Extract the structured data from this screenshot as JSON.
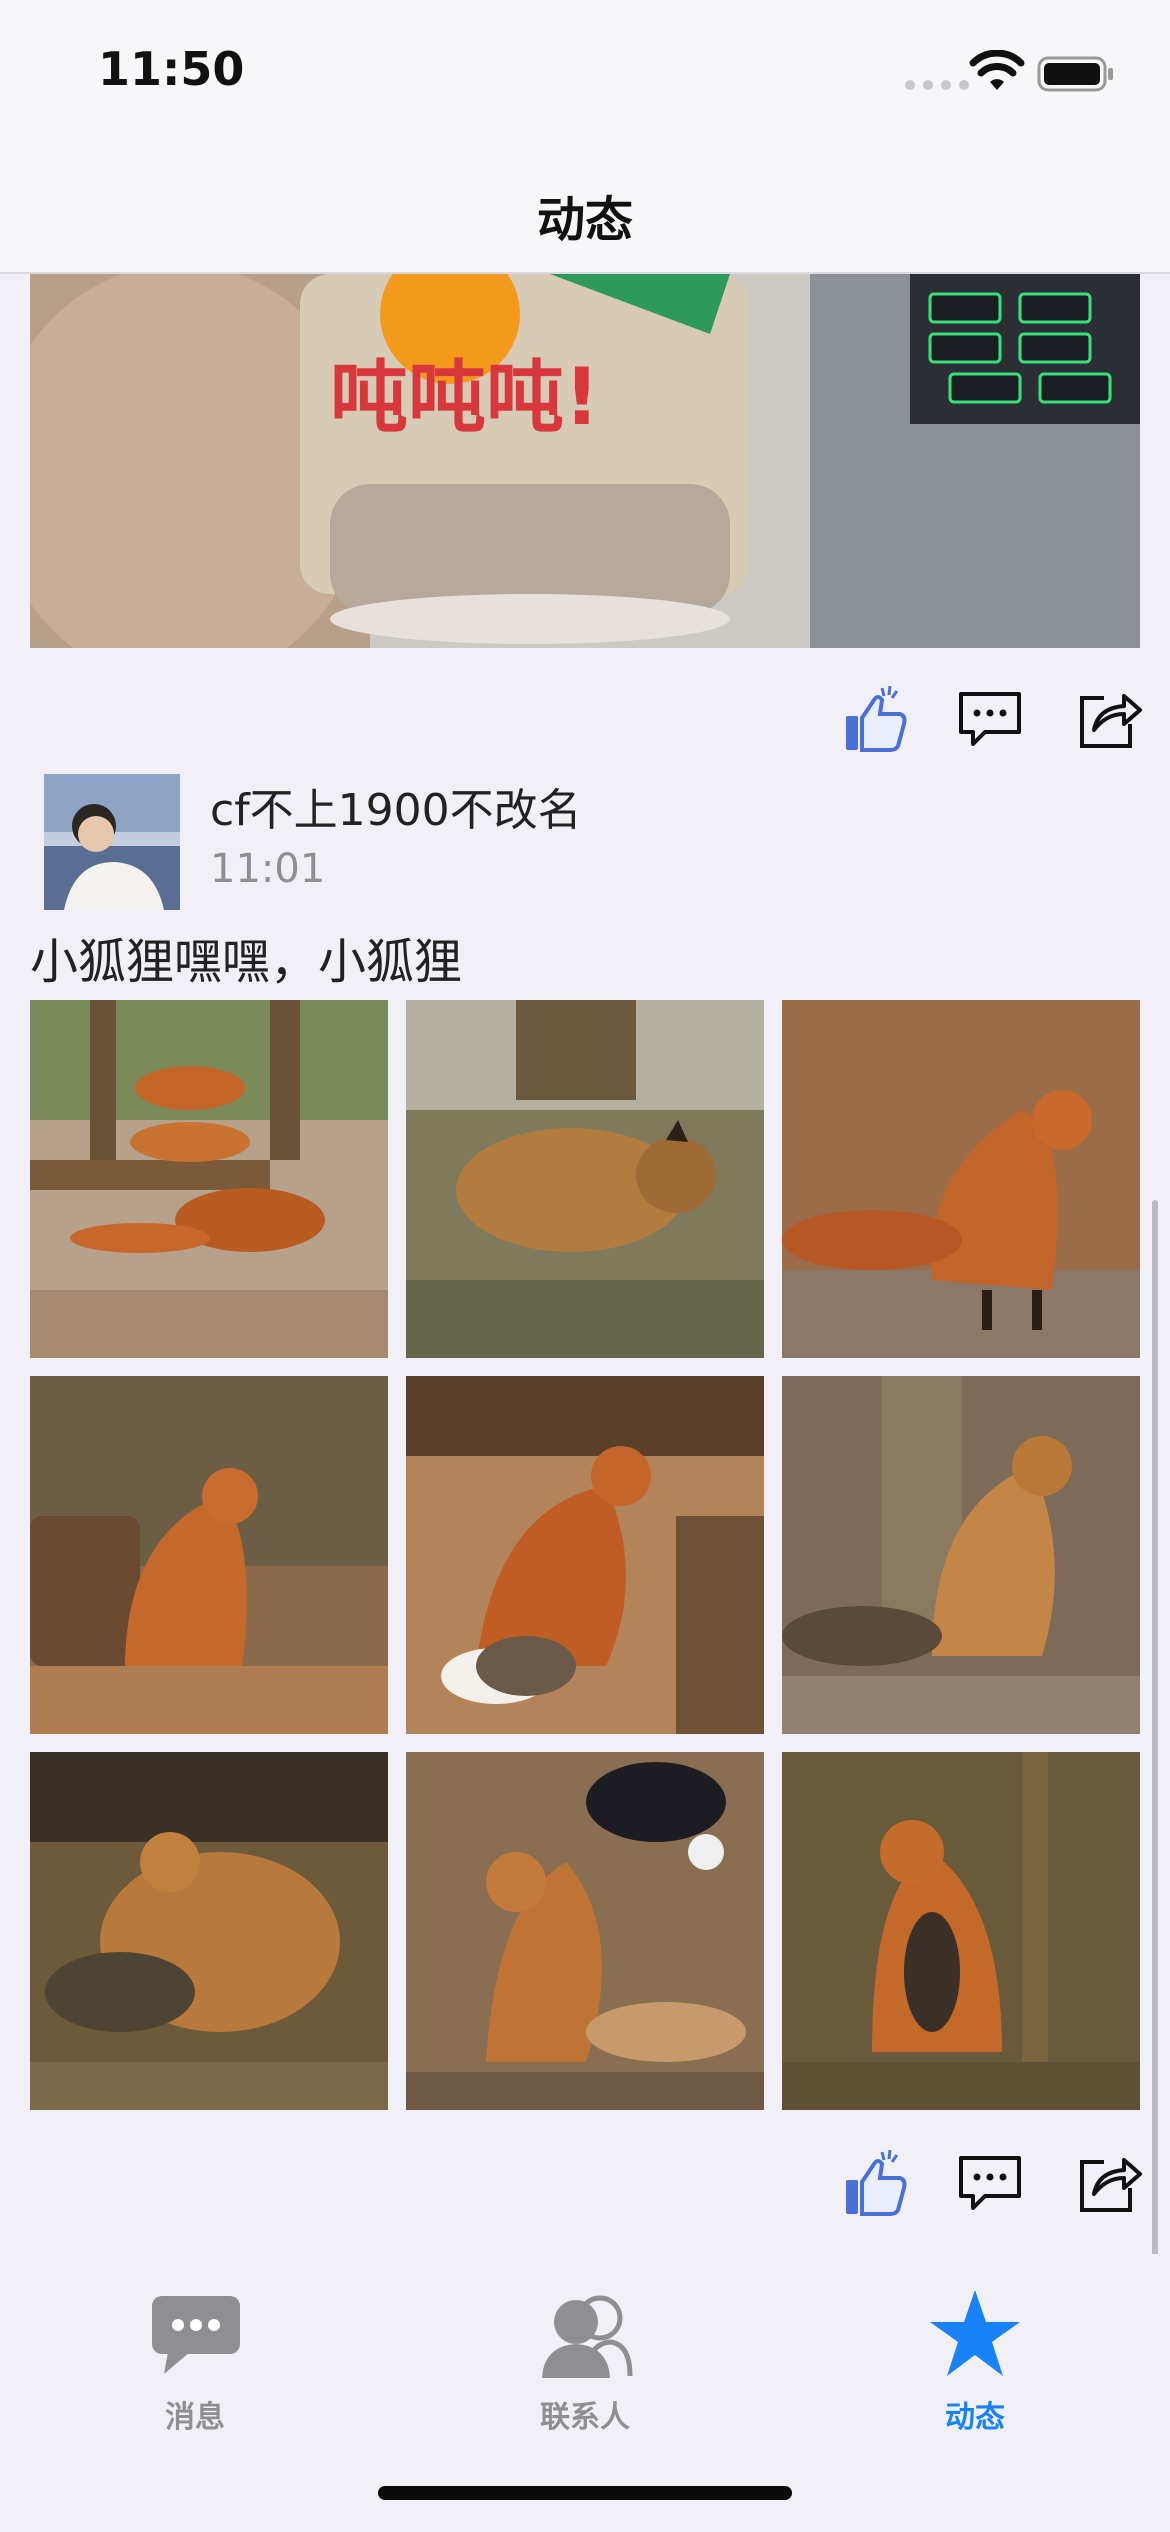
{
  "status_bar": {
    "time": "11:50"
  },
  "nav": {
    "title": "动态"
  },
  "post": {
    "username": "cf不上1900不改名",
    "time": "11:01",
    "text": "小狐狸嘿嘿，小狐狸",
    "image_count": 9
  },
  "top_photo_text": "吨吨吨!",
  "tabs": [
    {
      "label": "消息",
      "icon": "chat-bubble-icon",
      "active": false
    },
    {
      "label": "联系人",
      "icon": "contacts-icon",
      "active": false
    },
    {
      "label": "动态",
      "icon": "star-icon",
      "active": true
    }
  ],
  "colors": {
    "accent": "#1a82f7",
    "inactive": "#8e8e93",
    "like": "#4a6fd6"
  }
}
